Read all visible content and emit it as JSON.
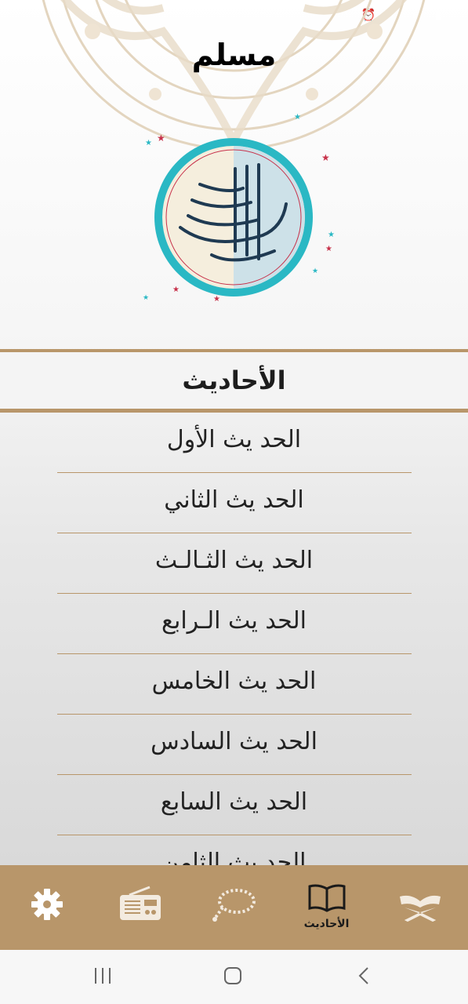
{
  "status_bar": {
    "time": "",
    "icons": [
      "alarm-icon",
      "mute-icon",
      "wifi-icon",
      "signal-icon",
      "battery-icon"
    ]
  },
  "header": {
    "title": "مسلم"
  },
  "emblem": {
    "alt": "بسم الله الرحمن الرحيم"
  },
  "section": {
    "title": "الأحاديث"
  },
  "hadith_list": [
    "الحد يث الأول",
    "الحد يث الثاني",
    "الحد يث الثـالـث",
    "الحد يث الـرابع",
    "الحد يث الخامس",
    "الحد يث السادس",
    "الحد يث السابع",
    "الحد يث الثامن"
  ],
  "bottom_nav": {
    "items": [
      {
        "icon": "quran-icon",
        "label": ""
      },
      {
        "icon": "book-icon",
        "label": "الأحاديث",
        "active": true
      },
      {
        "icon": "prayer-beads-icon",
        "label": ""
      },
      {
        "icon": "radio-icon",
        "label": ""
      },
      {
        "icon": "gear-icon",
        "label": ""
      }
    ]
  },
  "colors": {
    "accent": "#b8966a",
    "emblem_ring": "#2ab8c4",
    "text": "#222222"
  }
}
